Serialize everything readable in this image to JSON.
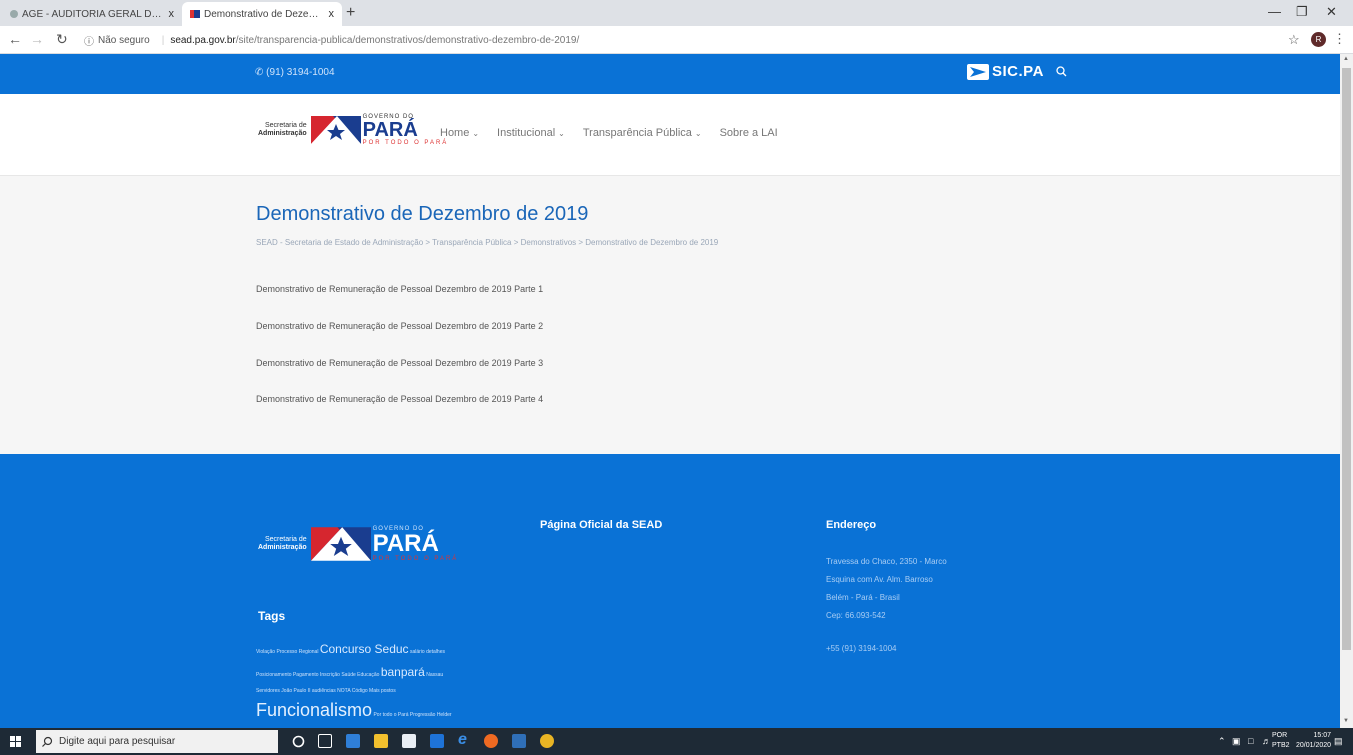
{
  "browser": {
    "tabs": [
      {
        "title": "AGE - AUDITORIA GERAL DO ES",
        "close": "x"
      },
      {
        "title": "Demonstrativo de Dezembro de",
        "close": "x"
      }
    ],
    "new_tab": "+",
    "insecure_label": "Não seguro",
    "url_host": "sead.pa.gov.br",
    "url_path": "/site/transparencia-publica/demonstrativos/demonstrativo-dezembro-de-2019/",
    "avatar_initial": "R"
  },
  "site": {
    "phone": "(91) 3194-1004",
    "sic_label": "SIC.PA",
    "logo": {
      "secretaria_line1": "Secretaria de",
      "secretaria_line2": "Administração",
      "gov_small": "GOVERNO DO",
      "gov_name": "PARÁ",
      "gov_motto": "POR TODO O PARÁ"
    },
    "nav": [
      {
        "label": "Home",
        "caret": "⌄"
      },
      {
        "label": "Institucional",
        "caret": "⌄"
      },
      {
        "label": "Transparência Pública",
        "caret": "⌄"
      },
      {
        "label": "Sobre a LAI",
        "caret": ""
      }
    ]
  },
  "main": {
    "title": "Demonstrativo de Dezembro de 2019",
    "breadcrumb": "SEAD - Secretaria de Estado de Administração > Transparência Pública > Demonstrativos > Demonstrativo de Dezembro de 2019",
    "documents": [
      "Demonstrativo de Remuneração de Pessoal Dezembro de 2019 Parte 1",
      "Demonstrativo de Remuneração de Pessoal Dezembro de 2019 Parte 2",
      "Demonstrativo de Remuneração de Pessoal Dezembro de 2019 Parte 3",
      "Demonstrativo de Remuneração de Pessoal Dezembro de 2019 Parte 4"
    ]
  },
  "footer": {
    "col2_title": "Página Oficial da SEAD",
    "col3_title": "Endereço",
    "address": [
      "Travessa do Chaco, 2350 - Marco",
      "Esquina com Av. Alm. Barroso",
      "Belém - Pará - Brasil",
      "Cep: 66.093-542"
    ],
    "phone": "+55 (91) 3194-1004",
    "tags_title": "Tags",
    "tags": {
      "line1_small": "Violação Processo Regional",
      "line1_big": "Concurso Seduc",
      "line1_tail": "salário detalhes",
      "line2_small": "Posicionamento Pagamento Inscrição Saúde Educação",
      "line2_big": "banpará",
      "line2_tail": "Nassau",
      "line3": "Servidores João Paulo II audiências NOTA Código Mais postos",
      "line4_big": "Funcionalismo",
      "line4_tail": "Por todo o Pará Progressão Helder"
    }
  },
  "taskbar": {
    "search_placeholder": "Digite aqui para pesquisar",
    "lang_top": "POR",
    "lang_bottom": "PTB2",
    "time": "15:07",
    "date": "20/01/2020"
  }
}
